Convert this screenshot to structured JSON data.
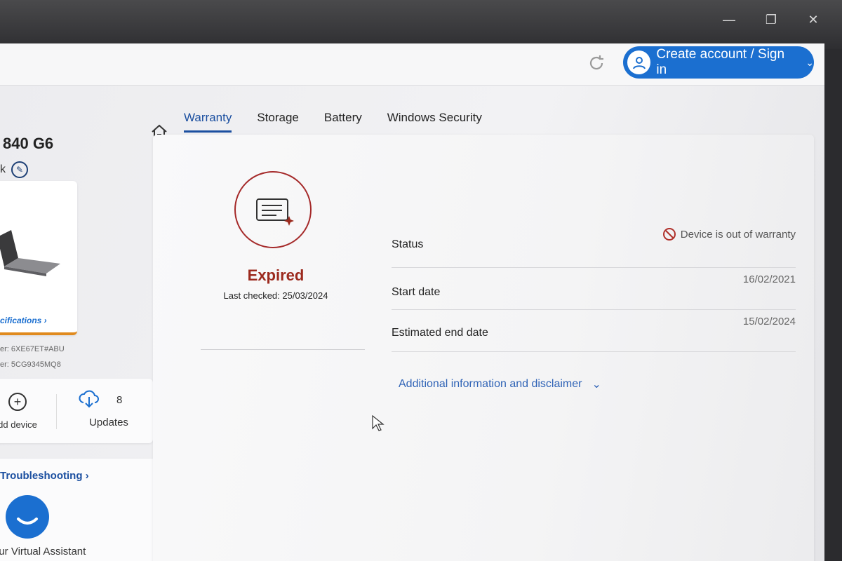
{
  "window": {
    "controls": [
      "—",
      "❐",
      "✕"
    ]
  },
  "header": {
    "refresh_icon": "refresh-icon",
    "account_label": "Create account / Sign in",
    "accent": "#1b6fd0"
  },
  "sidebar": {
    "device_name": "840 G6",
    "device_subtitle": "k",
    "specifications_link": "cifications ›",
    "product_number": "er: 6XE67ET#ABU",
    "serial_number": "er: 5CG9345MQ8",
    "add_device_label": "dd device",
    "updates_label": "Updates",
    "updates_count": "8",
    "troubleshooting_link": "Troubleshooting ›",
    "assistant_label": "our Virtual Assistant"
  },
  "tabs": [
    {
      "label": "Warranty",
      "active": true
    },
    {
      "label": "Storage",
      "active": false
    },
    {
      "label": "Battery",
      "active": false
    },
    {
      "label": "Windows Security",
      "active": false
    }
  ],
  "warranty": {
    "state": "Expired",
    "state_color": "#9c2a1e",
    "last_checked": "Last checked: 25/03/2024",
    "rows": [
      {
        "label": "Status",
        "value": "Device is out of warranty"
      },
      {
        "label": "Start date",
        "value": "16/02/2021"
      },
      {
        "label": "Estimated end date",
        "value": "15/02/2024"
      }
    ],
    "disclaimer_link": "Additional information and disclaimer"
  }
}
